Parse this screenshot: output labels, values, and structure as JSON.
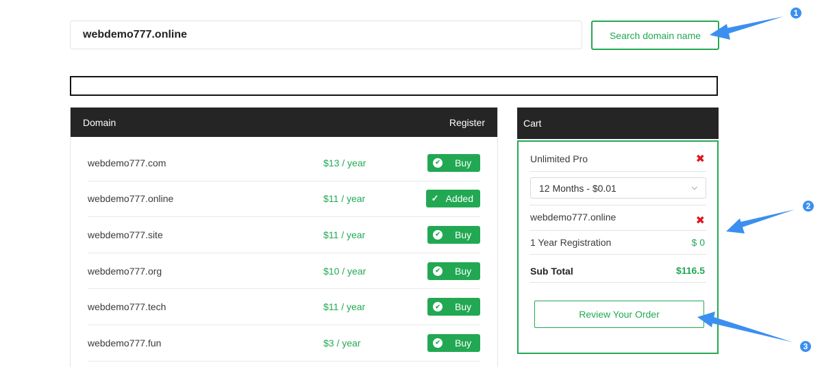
{
  "search": {
    "value": "webdemo777.online",
    "button_label": "Search domain name"
  },
  "domains": {
    "header_domain": "Domain",
    "header_register": "Register",
    "rows": [
      {
        "name": "webdemo777.com",
        "price": "$13 / year",
        "action": "Buy",
        "added": false
      },
      {
        "name": "webdemo777.online",
        "price": "$11 / year",
        "action": "Added",
        "added": true
      },
      {
        "name": "webdemo777.site",
        "price": "$11 / year",
        "action": "Buy",
        "added": false
      },
      {
        "name": "webdemo777.org",
        "price": "$10 / year",
        "action": "Buy",
        "added": false
      },
      {
        "name": "webdemo777.tech",
        "price": "$11 / year",
        "action": "Buy",
        "added": false
      },
      {
        "name": "webdemo777.fun",
        "price": "$3 / year",
        "action": "Buy",
        "added": false
      }
    ]
  },
  "cart": {
    "title": "Cart",
    "plan_name": "Unlimited Pro",
    "plan_option": "12 Months - $0.01",
    "domain_name": "webdemo777.online",
    "registration_label": "1 Year Registration",
    "registration_price": "$ 0",
    "subtotal_label": "Sub Total",
    "subtotal_value": "$116.5",
    "review_button": "Review Your Order"
  },
  "annotations": {
    "badge_1": "1",
    "badge_2": "2",
    "badge_3": "3"
  },
  "colors": {
    "accent_green": "#22a853",
    "header_dark": "#252525",
    "remove_red": "#e0151d",
    "annotation_blue": "#3b8ff0"
  },
  "icons": [
    "check-circle-icon",
    "checkmark-icon",
    "remove-x-icon",
    "chevron-down-icon",
    "annotation-arrow-icon"
  ]
}
